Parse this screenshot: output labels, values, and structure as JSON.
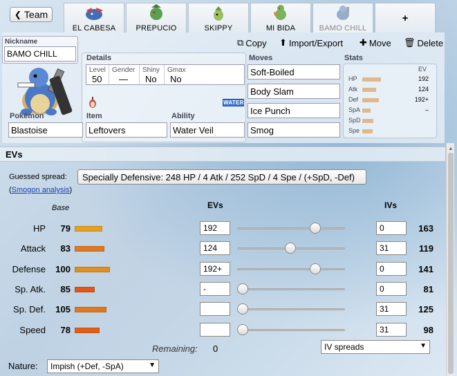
{
  "team_button_label": "Team",
  "tabs": [
    {
      "label": "EL CABESA",
      "color": "#3f6fb5"
    },
    {
      "label": "PREPUCIO",
      "color": "#5aa050"
    },
    {
      "label": "SKIPPY",
      "color": "#9cc060"
    },
    {
      "label": "MI BIDA",
      "color": "#7bb35d"
    },
    {
      "label": "BAMO CHILL",
      "color": "#5b7fb0"
    }
  ],
  "add_tab_label": "+",
  "nickname": {
    "label": "Nickname",
    "value": "BAMO CHILL"
  },
  "actions": {
    "copy": "Copy",
    "import_export": "Import/Export",
    "move": "Move",
    "delete": "Delete"
  },
  "sections": {
    "details": "Details",
    "moves": "Moves",
    "stats": "Stats",
    "pokemon": "Pokémon",
    "item": "Item",
    "ability": "Ability"
  },
  "details": {
    "level_label": "Level",
    "level": "50",
    "gender_label": "Gender",
    "gender": "—",
    "shiny_label": "Shiny",
    "shiny": "No",
    "gmax_label": "Gmax",
    "gmax": "No"
  },
  "type_badge": "WATER",
  "pokemon": "Blastoise",
  "item": "Leftovers",
  "ability": "Water Veil",
  "moves": [
    "Soft-Boiled",
    "Body Slam",
    "Ice Punch",
    "Smog"
  ],
  "stats_summary": {
    "ev_header": "EV",
    "rows": [
      {
        "label": "HP",
        "ev": "192",
        "fill": 0.45
      },
      {
        "label": "Atk",
        "ev": "124",
        "fill": 0.33
      },
      {
        "label": "Def",
        "ev": "192+",
        "fill": 0.4
      },
      {
        "label": "SpA",
        "ev": "–",
        "fill": 0.2
      },
      {
        "label": "SpD",
        "ev": "",
        "fill": 0.27
      },
      {
        "label": "Spe",
        "ev": "",
        "fill": 0.25
      }
    ]
  },
  "evs": {
    "header": "EVs",
    "guessed_label": "Guessed spread:",
    "guessed_value": "Specially Defensive: 248 HP / 4 Atk / 252 SpD / 4 Spe / (+SpD, -Def)",
    "smogon_open": "(",
    "smogon_link": "Smogon analysis",
    "smogon_close": ")",
    "col_base": "Base",
    "col_evs": "EVs",
    "col_ivs": "IVs",
    "rows": [
      {
        "name": "HP",
        "base": "79",
        "ev": "192",
        "slider": 0.75,
        "iv": "0",
        "total": "163",
        "bar_color": "#e8a020",
        "bar_fill": 0.31
      },
      {
        "name": "Attack",
        "base": "83",
        "ev": "124",
        "slider": 0.49,
        "iv": "31",
        "total": "119",
        "bar_color": "#e07820",
        "bar_fill": 0.33
      },
      {
        "name": "Defense",
        "base": "100",
        "ev": "192+",
        "slider": 0.75,
        "iv": "0",
        "total": "141",
        "bar_color": "#e09020",
        "bar_fill": 0.39
      },
      {
        "name": "Sp. Atk.",
        "base": "85",
        "ev": "-",
        "slider": 0.0,
        "iv": "0",
        "total": "81",
        "bar_color": "#e05818",
        "bar_fill": 0.22
      },
      {
        "name": "Sp. Def.",
        "base": "105",
        "ev": "",
        "slider": 0.0,
        "iv": "31",
        "total": "125",
        "bar_color": "#e07820",
        "bar_fill": 0.35
      },
      {
        "name": "Speed",
        "base": "78",
        "ev": "",
        "slider": 0.0,
        "iv": "31",
        "total": "98",
        "bar_color": "#e06018",
        "bar_fill": 0.28
      }
    ],
    "remaining_label": "Remaining:",
    "remaining_value": "0",
    "iv_spreads": "IV spreads",
    "nature_label": "Nature:",
    "nature_value": "Impish (+Def, -SpA)"
  }
}
